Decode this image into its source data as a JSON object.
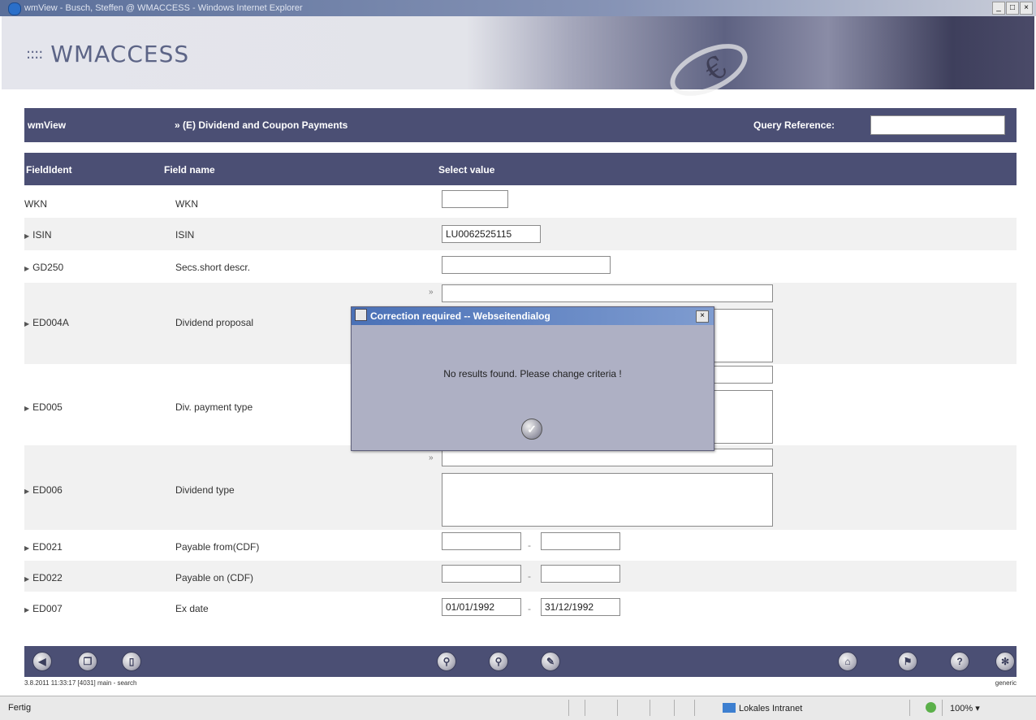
{
  "window": {
    "title": "wmView - Busch, Steffen @ WMACCESS - Windows Internet Explorer",
    "minimize": "_",
    "maximize": "□",
    "close": "×"
  },
  "banner": {
    "logo_dots": "::::",
    "logo_text": "WMACCESS",
    "euro": "€"
  },
  "header": {
    "app_name": "wmView",
    "breadcrumb": "» (E) Dividend and Coupon Payments",
    "query_reference_label": "Query Reference:",
    "query_reference_value": ""
  },
  "table": {
    "columns": [
      "FieldIdent",
      "Field name",
      "Select value"
    ],
    "rows": [
      {
        "ident": "WKN",
        "name": "WKN",
        "value": ""
      },
      {
        "ident": "ISIN",
        "name": "ISIN",
        "value": "LU0062525115"
      },
      {
        "ident": "GD250",
        "name": "Secs.short descr.",
        "value": ""
      },
      {
        "ident": "ED004A",
        "name": "Dividend proposal",
        "value": ""
      },
      {
        "ident": "ED005",
        "name": "Div. payment type",
        "value": ""
      },
      {
        "ident": "ED006",
        "name": "Dividend type",
        "value": ""
      },
      {
        "ident": "ED021",
        "name": "Payable from(CDF)",
        "value_from": "",
        "value_to": ""
      },
      {
        "ident": "ED022",
        "name": "Payable on (CDF)",
        "value_from": "",
        "value_to": ""
      },
      {
        "ident": "ED007",
        "name": "Ex date",
        "value_from": "01/01/1992",
        "value_to": "31/12/1992"
      }
    ],
    "range_separator": "-",
    "list_marker": "»"
  },
  "dialog": {
    "title": "Correction required -- Webseitendialog",
    "message": "No results found. Please change criteria !",
    "close": "×",
    "ok_symbol": "✓"
  },
  "toolbar": {
    "icons": [
      "back-icon",
      "copy-icon",
      "document-icon",
      "search-icon",
      "zoom-icon",
      "edit-icon",
      "home-icon",
      "flag-icon",
      "help-icon",
      "settings-icon"
    ],
    "glyphs": {
      "back": "◀",
      "copy": "❐",
      "document": "▯",
      "search": "⚲",
      "zoom": "⚲",
      "edit": "✎",
      "home": "⌂",
      "flag": "⚑",
      "help": "?",
      "settings": "✻"
    }
  },
  "statusline": {
    "left": "3.8.2011 11:33:17 [4031] main - search",
    "right": "generic"
  },
  "ie_status": {
    "left": "Fertig",
    "zone": "Lokales Intranet",
    "zoom": "100%",
    "zoom_arrow": "▾"
  }
}
